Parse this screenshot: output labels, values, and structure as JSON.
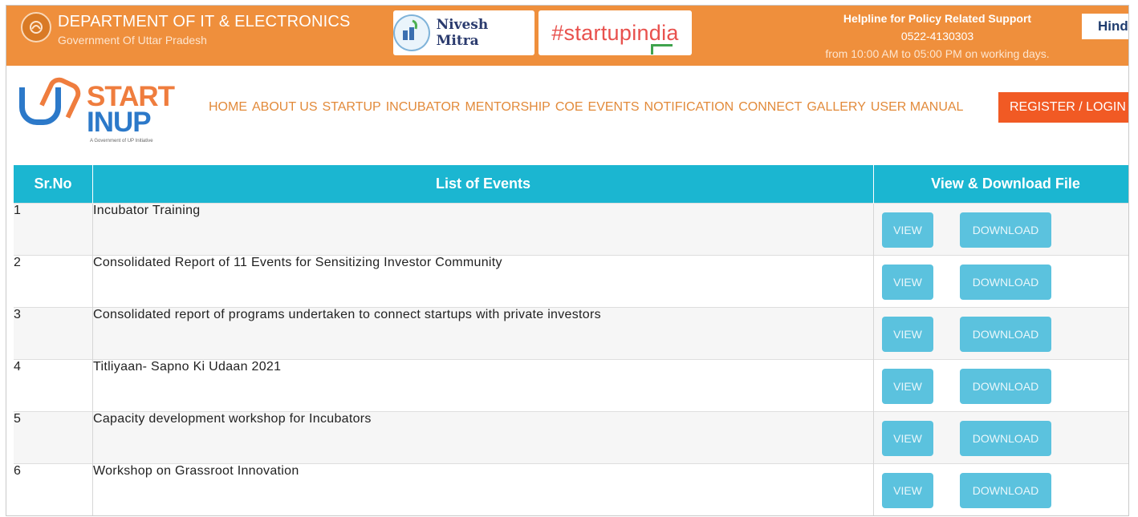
{
  "header": {
    "department": "DEPARTMENT OF IT & ELECTRONICS",
    "government": "Government Of Uttar Pradesh",
    "nivesh_mitra": "Nivesh Mitra",
    "startupindia": "#startupindia",
    "helpline_title": "Helpline for Policy Related Support",
    "helpline_phone": "0522-4130303",
    "helpline_hours": "from 10:00 AM to 05:00 PM on working days.",
    "language_button": "Hind"
  },
  "logo": {
    "line1": "START",
    "line2": "INUP",
    "tagline": "A Government of UP Initiative"
  },
  "nav": {
    "items": [
      "HOME",
      "ABOUT US",
      "STARTUP",
      "INCUBATOR",
      "MENTORSHIP",
      "COE",
      "EVENTS",
      "NOTIFICATION",
      "CONNECT",
      "GALLERY",
      "USER MANUAL"
    ],
    "register": "REGISTER / LOGIN"
  },
  "table": {
    "headers": [
      "Sr.No",
      "List of Events",
      "View & Download File"
    ],
    "view_label": "VIEW",
    "download_label": "DOWNLOAD",
    "rows": [
      {
        "sr": "1",
        "event": "Incubator Training"
      },
      {
        "sr": "2",
        "event": "Consolidated Report of 11 Events for Sensitizing Investor Community"
      },
      {
        "sr": "3",
        "event": "Consolidated report of programs undertaken to connect startups with private investors"
      },
      {
        "sr": "4",
        "event": "Titliyaan- Sapno Ki Udaan 2021"
      },
      {
        "sr": "5",
        "event": "Capacity development workshop for Incubators"
      },
      {
        "sr": "6",
        "event": "Workshop on Grassroot Innovation"
      }
    ]
  },
  "colors": {
    "topbar": "#ef8f3c",
    "table_header": "#1bb6d1",
    "button": "#5bc2de",
    "register": "#f15a24",
    "nav_text": "#e28a3a"
  }
}
